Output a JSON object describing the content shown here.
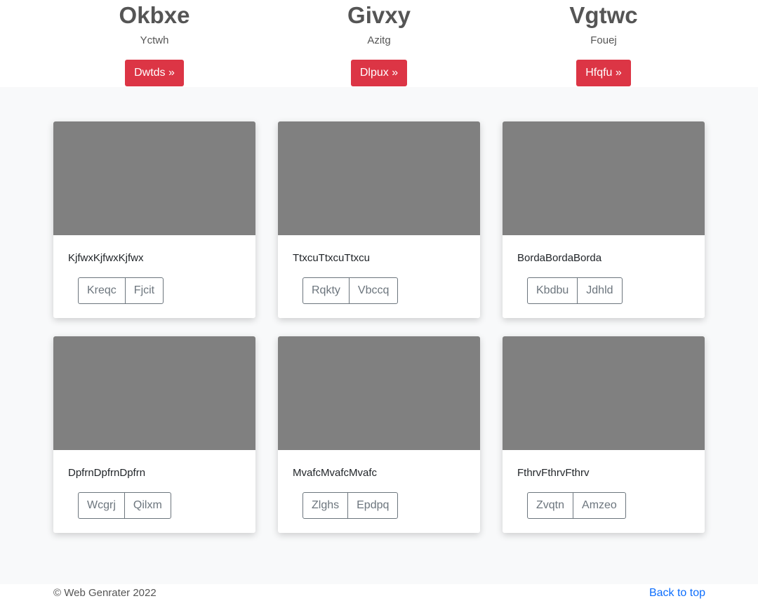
{
  "features": [
    {
      "heading": "Okbxe",
      "subtitle": "Yctwh",
      "button": "Dwtds »"
    },
    {
      "heading": "Givxy",
      "subtitle": "Azitg",
      "button": "Dlpux »"
    },
    {
      "heading": "Vgtwc",
      "subtitle": "Fouej",
      "button": "Hfqfu »"
    }
  ],
  "cards": [
    {
      "text": "KjfwxKjfwxKjfwx",
      "buttons": [
        "Kreqc",
        "Fjcit"
      ]
    },
    {
      "text": "TtxcuTtxcuTtxcu",
      "buttons": [
        "Rqkty",
        "Vbccq"
      ]
    },
    {
      "text": "BordaBordaBorda",
      "buttons": [
        "Kbdbu",
        "Jdhld"
      ]
    },
    {
      "text": "DpfrnDpfrnDpfrn",
      "buttons": [
        "Wcgrj",
        "Qilxm"
      ]
    },
    {
      "text": "MvafcMvafcMvafc",
      "buttons": [
        "Zlghs",
        "Epdpq"
      ]
    },
    {
      "text": "FthrvFthrvFthrv",
      "buttons": [
        "Zvqtn",
        "Amzeo"
      ]
    }
  ],
  "footer": {
    "copyright": "© Web Genrater 2022",
    "back_to_top": "Back to top"
  },
  "colors": {
    "accent_button": "#dc3545",
    "placeholder_image": "#808080",
    "link": "#0d6efd"
  }
}
